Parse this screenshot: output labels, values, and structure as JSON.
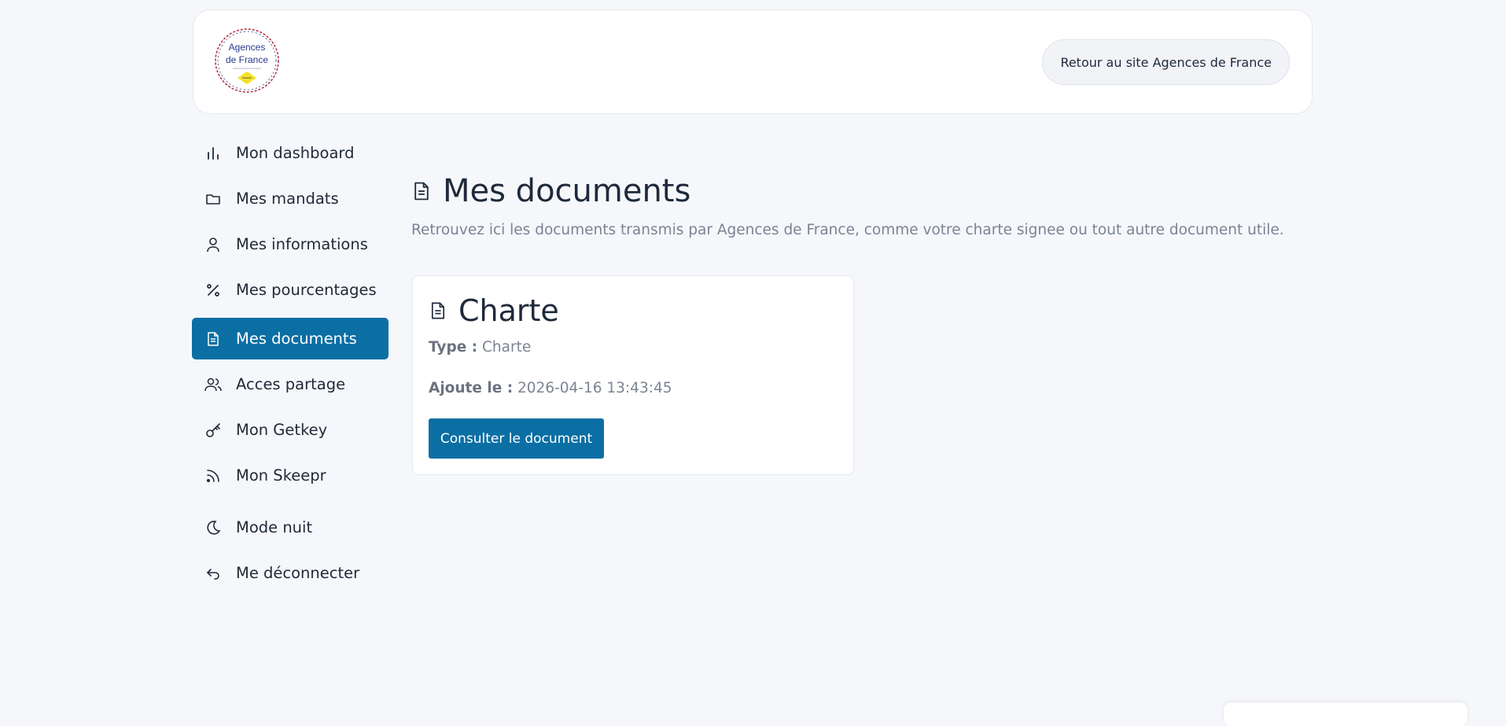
{
  "header": {
    "logo_lines": [
      "Agences",
      "de France"
    ],
    "back_button_label": "Retour au site Agences de France"
  },
  "sidebar": {
    "items": [
      {
        "label": "Mon dashboard",
        "icon": "bar-chart-icon"
      },
      {
        "label": "Mes mandats",
        "icon": "folder-icon"
      },
      {
        "label": "Mes informations",
        "icon": "user-icon"
      },
      {
        "label": "Mes pourcentages",
        "icon": "percent-icon"
      },
      {
        "label": "Mes documents",
        "icon": "document-icon",
        "active": true
      },
      {
        "label": "Acces partage",
        "icon": "users-icon"
      },
      {
        "label": "Mon Getkey",
        "icon": "key-icon"
      },
      {
        "label": "Mon Skeepr",
        "icon": "rss-icon"
      },
      {
        "label": "Mode nuit",
        "icon": "moon-icon"
      },
      {
        "label": "Me déconnecter",
        "icon": "logout-arrow-icon"
      }
    ]
  },
  "main": {
    "title": "Mes documents",
    "subtitle": "Retrouvez ici les documents transmis par Agences de France, comme votre charte signee ou tout autre document utile.",
    "card": {
      "title": "Charte",
      "type_label": "Type :",
      "type_value": "Charte",
      "added_label": "Ajoute le :",
      "added_value": "2026-04-16 13:43:45",
      "button_label": "Consulter le document"
    }
  },
  "colors": {
    "accent": "#0b6fa4",
    "background": "#f5f7fa",
    "text": "#1e2a3b",
    "muted": "#7b8494"
  }
}
